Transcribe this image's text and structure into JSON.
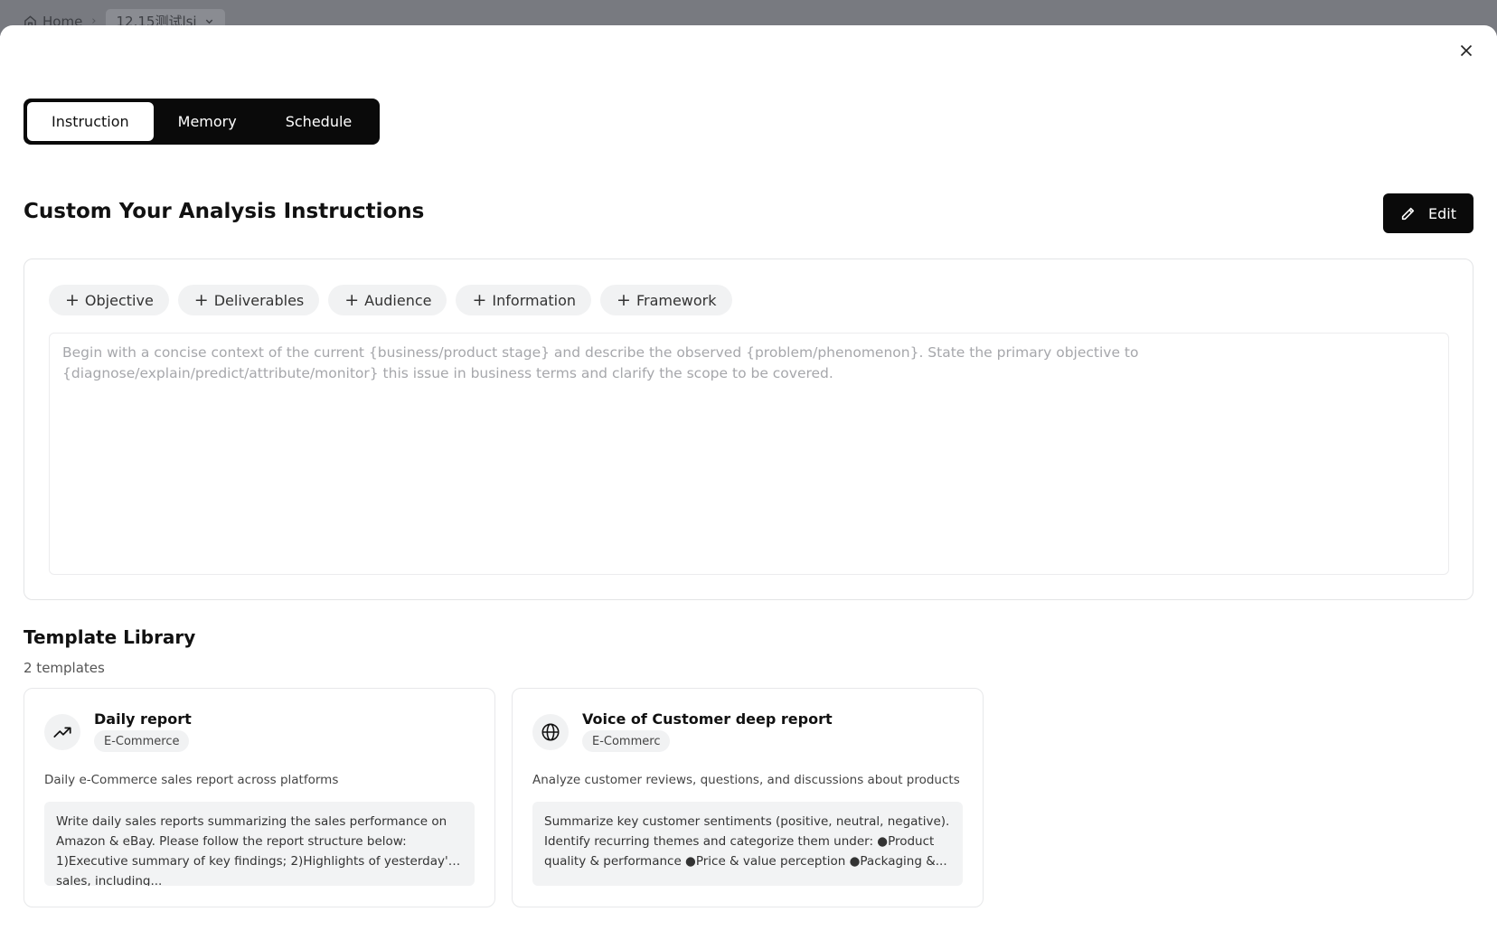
{
  "background": {
    "breadcrumb": {
      "home": "Home",
      "project": "12.15测试lsi"
    }
  },
  "modal": {
    "tabs": [
      {
        "label": "Instruction",
        "active": true
      },
      {
        "label": "Memory",
        "active": false
      },
      {
        "label": "Schedule",
        "active": false
      }
    ],
    "section_title": "Custom Your Analysis Instructions",
    "edit_label": "Edit",
    "chips": [
      "Objective",
      "Deliverables",
      "Audience",
      "Information",
      "Framework"
    ],
    "instruction_placeholder": "Begin with a concise context of the current {business/product stage} and describe the observed {problem/phenomenon}. State the primary objective to {diagnose/explain/predict/attribute/monitor} this issue in business terms and clarify the scope to be covered.",
    "library": {
      "title": "Template Library",
      "count": "2 templates",
      "templates": [
        {
          "name": "Daily report",
          "tag": "E-Commerce",
          "icon": "trending-up-icon",
          "description": "Daily e-Commerce sales report across platforms",
          "body": "Write daily sales reports summarizing the sales performance on Amazon & eBay. Please follow the report structure below: 1)Executive summary of key findings; 2)Highlights of yesterday's sales, including..."
        },
        {
          "name": "Voice of Customer deep report",
          "tag": "E-Commerc",
          "icon": "globe-icon",
          "description": "Analyze customer reviews, questions, and discussions about products",
          "body": "Summarize key customer sentiments (positive, neutral, negative). Identify recurring themes and categorize them under: ●Product quality & performance ●Price & value perception ●Packaging &..."
        }
      ]
    }
  },
  "colors": {
    "primary": "#0a0a0a",
    "chip_bg": "#f1f2f3",
    "placeholder": "#a6a7ab",
    "backdrop": "#787a80"
  }
}
